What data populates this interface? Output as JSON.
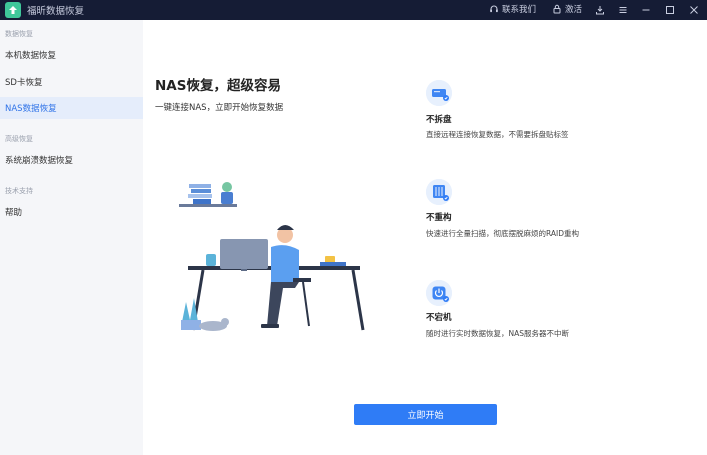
{
  "window": {
    "title": "福昕数据恢复",
    "contact_label": "联系我们",
    "activate_label": "激活"
  },
  "sidebar": {
    "groups": [
      {
        "label": "数据恢复",
        "items": [
          {
            "label": "本机数据恢复"
          },
          {
            "label": "SD卡恢复"
          },
          {
            "label": "NAS数据恢复"
          }
        ]
      },
      {
        "label": "高级恢复",
        "items": [
          {
            "label": "系统崩溃数据恢复"
          }
        ]
      },
      {
        "label": "技术支持",
        "items": [
          {
            "label": "帮助"
          }
        ]
      }
    ],
    "active": "NAS数据恢复"
  },
  "main": {
    "headline": "NAS恢复，超级容易",
    "subline": "一键连接NAS，立即开始恢复数据",
    "features": [
      {
        "icon": "nas-disk-icon",
        "title": "不拆盘",
        "desc": "直接远程连接恢复数据，不需要拆盘贴标签"
      },
      {
        "icon": "raid-structure-icon",
        "title": "不重构",
        "desc": "快速进行全量扫描，彻底摆脱麻烦的RAID重构"
      },
      {
        "icon": "power-icon",
        "title": "不宕机",
        "desc": "随时进行实时数据恢复，NAS服务器不中断"
      }
    ],
    "start_button": "立即开始"
  },
  "colors": {
    "accent": "#2f7cf6",
    "titlebar": "#151c35",
    "sidebar": "#f5f6f9",
    "active_bg": "#e5edfb"
  }
}
